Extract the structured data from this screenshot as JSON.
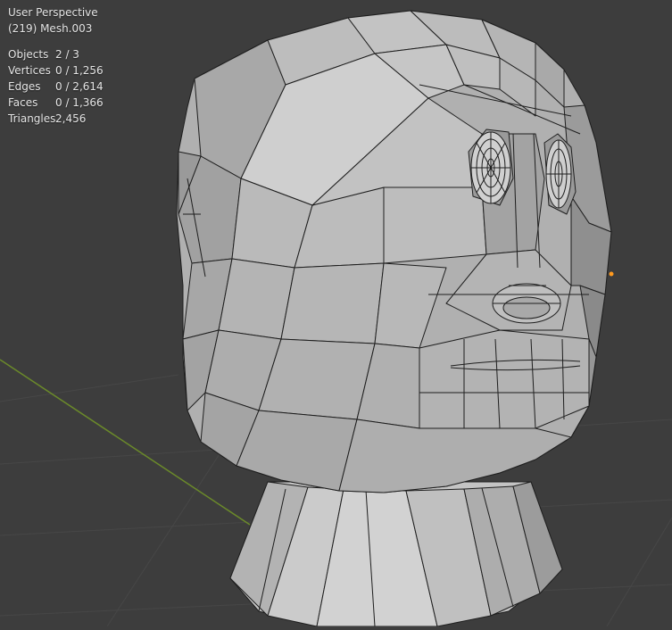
{
  "viewport": {
    "view_name": "User Perspective",
    "active_object": "(219) Mesh.003",
    "stats": [
      {
        "label": "Objects",
        "value": "2 / 3"
      },
      {
        "label": "Vertices",
        "value": "0 / 1,256"
      },
      {
        "label": "Edges",
        "value": "0 / 2,614"
      },
      {
        "label": "Faces",
        "value": "0 / 1,366"
      },
      {
        "label": "Triangles",
        "value": "2,456"
      }
    ],
    "colors": {
      "background": "#3d3d3d",
      "grid": "#474747",
      "x_axis": "#6b8a2a",
      "mesh_light": "#bdbdbd",
      "mesh_mid": "#a5a5a5",
      "mesh_dark": "#8a8a8a",
      "wire": "#1e1e1e",
      "origin_marker": "#ff9a1f"
    }
  }
}
